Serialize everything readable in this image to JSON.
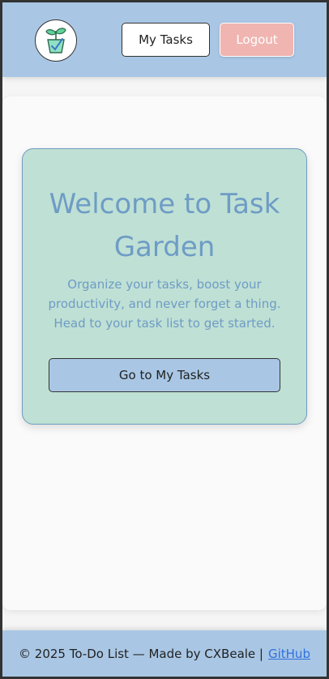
{
  "header": {
    "logo_icon": "plant-pot-icon",
    "my_tasks_label": "My Tasks",
    "logout_label": "Logout"
  },
  "welcome": {
    "title": "Welcome to Task Garden",
    "description": "Organize your tasks, boost your productivity, and never forget a thing. Head to your task list to get started.",
    "cta_label": "Go to My Tasks"
  },
  "footer": {
    "text": "© 2025 To-Do List — Made by CXBeale |",
    "link_label": "GitHub"
  },
  "colors": {
    "header_bg": "#a9c7e5",
    "logout_bg": "#f0b5b1",
    "card_bg": "#bfe0d4",
    "title_color": "#6e9cc6",
    "link_color": "#2f6fde"
  }
}
